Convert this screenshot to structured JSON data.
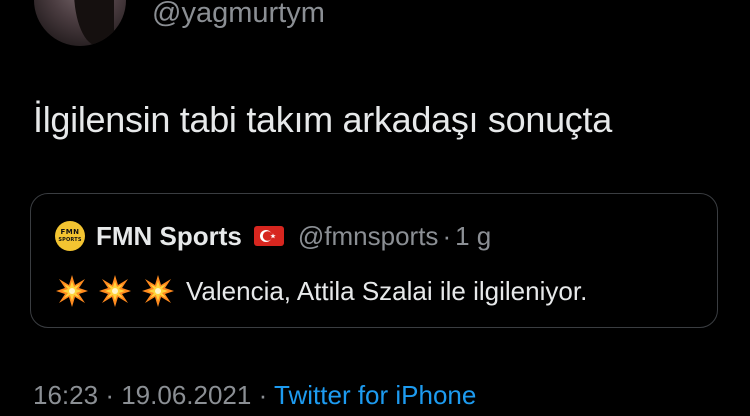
{
  "tweet": {
    "handle": "@yagmurtym",
    "text": "İlgilensin tabi takım arkadaşı sonuçta",
    "time": "16:23",
    "separator": "·",
    "date": "19.06.2021",
    "source": "Twitter for iPhone"
  },
  "quote": {
    "logo_top": "FMN",
    "logo_bottom": "SPORTS",
    "name": "FMN Sports",
    "handle": "@fmnsports",
    "separator": "·",
    "age": "1 g",
    "text": "Valencia, Attila Szalai ile ilgileniyor."
  },
  "colors": {
    "background": "#000000",
    "text": "#e7e9ea",
    "muted": "#8b8f94",
    "link": "#1d9bf0",
    "card_border": "#3a3d41",
    "logo": "#f3c431",
    "flag": "#d7261f"
  },
  "icons": [
    "avatar",
    "fmn-sports-logo",
    "turkey-flag-icon",
    "collision-burst-icon"
  ]
}
